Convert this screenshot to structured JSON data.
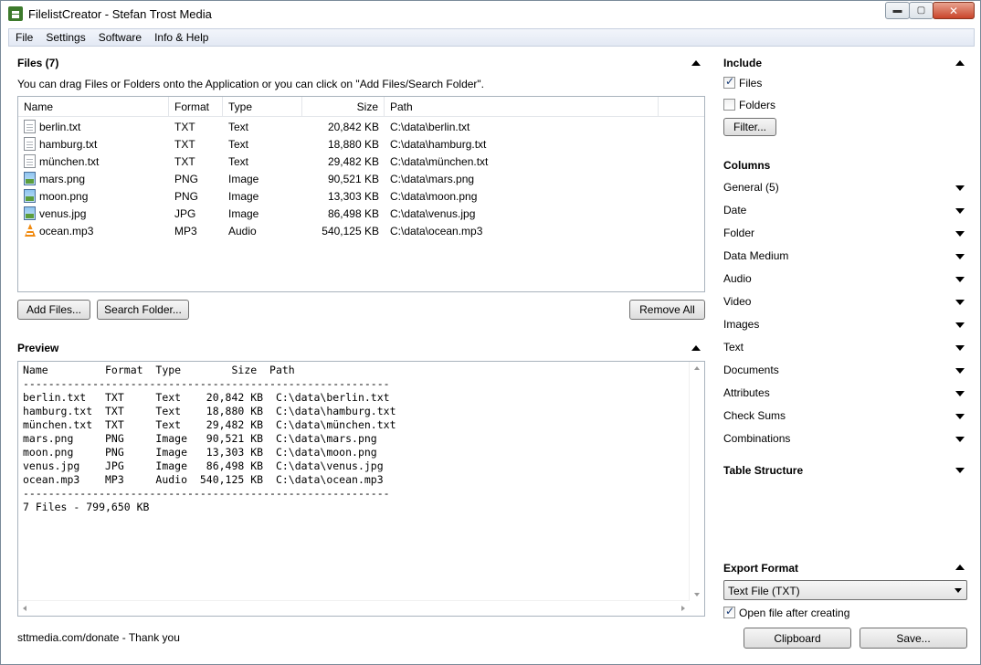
{
  "window": {
    "title": "FilelistCreator - Stefan Trost Media",
    "app_icon": "filelist-app-icon",
    "controls": {
      "minimize": "▬",
      "maximize": "▢",
      "close": "✕"
    }
  },
  "menu": [
    "File",
    "Settings",
    "Software",
    "Info & Help"
  ],
  "files": {
    "title": "Files (7)",
    "hint": "You can drag Files or Folders onto the Application or you can click on \"Add Files/Search Folder\".",
    "columns": [
      "Name",
      "Format",
      "Type",
      "Size",
      "Path"
    ],
    "rows": [
      {
        "icon": "txt",
        "name": "berlin.txt",
        "format": "TXT",
        "type": "Text",
        "size": "20,842 KB",
        "path": "C:\\data\\berlin.txt"
      },
      {
        "icon": "txt",
        "name": "hamburg.txt",
        "format": "TXT",
        "type": "Text",
        "size": "18,880 KB",
        "path": "C:\\data\\hamburg.txt"
      },
      {
        "icon": "txt",
        "name": "münchen.txt",
        "format": "TXT",
        "type": "Text",
        "size": "29,482 KB",
        "path": "C:\\data\\münchen.txt"
      },
      {
        "icon": "img",
        "name": "mars.png",
        "format": "PNG",
        "type": "Image",
        "size": "90,521 KB",
        "path": "C:\\data\\mars.png"
      },
      {
        "icon": "img",
        "name": "moon.png",
        "format": "PNG",
        "type": "Image",
        "size": "13,303 KB",
        "path": "C:\\data\\moon.png"
      },
      {
        "icon": "img",
        "name": "venus.jpg",
        "format": "JPG",
        "type": "Image",
        "size": "86,498 KB",
        "path": "C:\\data\\venus.jpg"
      },
      {
        "icon": "audio",
        "name": "ocean.mp3",
        "format": "MP3",
        "type": "Audio",
        "size": "540,125 KB",
        "path": "C:\\data\\ocean.mp3"
      }
    ],
    "buttons": {
      "add_files": "Add Files...",
      "search_folder": "Search Folder...",
      "remove_all": "Remove All"
    }
  },
  "preview": {
    "title": "Preview",
    "text": "Name         Format  Type        Size  Path\n----------------------------------------------------------\nberlin.txt   TXT     Text    20,842 KB  C:\\data\\berlin.txt\nhamburg.txt  TXT     Text    18,880 KB  C:\\data\\hamburg.txt\nmünchen.txt  TXT     Text    29,482 KB  C:\\data\\münchen.txt\nmars.png     PNG     Image   90,521 KB  C:\\data\\mars.png\nmoon.png     PNG     Image   13,303 KB  C:\\data\\moon.png\nvenus.jpg    JPG     Image   86,498 KB  C:\\data\\venus.jpg\nocean.mp3    MP3     Audio  540,125 KB  C:\\data\\ocean.mp3\n----------------------------------------------------------\n7 Files - 799,650 KB"
  },
  "footer": {
    "donate": "sttmedia.com/donate - Thank you"
  },
  "include": {
    "title": "Include",
    "files_label": "Files",
    "files_checked": true,
    "folders_label": "Folders",
    "folders_checked": false,
    "filter_button": "Filter..."
  },
  "columns_panel": {
    "title": "Columns",
    "items": [
      "General (5)",
      "Date",
      "Folder",
      "Data Medium",
      "Audio",
      "Video",
      "Images",
      "Text",
      "Documents",
      "Attributes",
      "Check Sums",
      "Combinations"
    ]
  },
  "table_structure": {
    "title": "Table Structure"
  },
  "export": {
    "title": "Export Format",
    "selected": "Text File (TXT)",
    "open_after_label": "Open file after creating",
    "open_after_checked": true,
    "clipboard_button": "Clipboard",
    "save_button": "Save..."
  }
}
